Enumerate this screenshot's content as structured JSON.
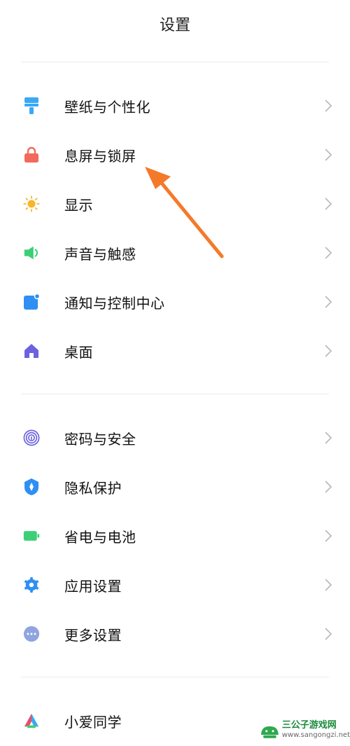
{
  "header": {
    "title": "设置"
  },
  "group1": [
    {
      "label": "壁纸与个性化",
      "icon": "wallpaper-brush-icon",
      "color": "#3aa8f5"
    },
    {
      "label": "息屏与锁屏",
      "icon": "lock-icon",
      "color": "#f26a5b"
    },
    {
      "label": "显示",
      "icon": "sun-brightness-icon",
      "color": "#f7b52b"
    },
    {
      "label": "声音与触感",
      "icon": "speaker-icon",
      "color": "#3ccf75"
    },
    {
      "label": "通知与控制中心",
      "icon": "notification-icon",
      "color": "#2f8ff3"
    },
    {
      "label": "桌面",
      "icon": "home-icon",
      "color": "#6a62e0"
    }
  ],
  "group2": [
    {
      "label": "密码与安全",
      "icon": "fingerprint-icon",
      "color": "#6a62e0"
    },
    {
      "label": "隐私保护",
      "icon": "privacy-shield-icon",
      "color": "#2f8ff3"
    },
    {
      "label": "省电与电池",
      "icon": "battery-icon",
      "color": "#3ccf75"
    },
    {
      "label": "应用设置",
      "icon": "gear-icon",
      "color": "#2f8ff3"
    },
    {
      "label": "更多设置",
      "icon": "more-dots-icon",
      "color": "#8fa4e0"
    }
  ],
  "group3": [
    {
      "label": "小爱同学",
      "icon": "xiaoai-assistant-icon",
      "color": "#e94d6b"
    }
  ],
  "annotation": {
    "color": "#f47a2a"
  },
  "watermark": {
    "name": "三公子游戏网",
    "url": "www.sangongzi.net"
  }
}
